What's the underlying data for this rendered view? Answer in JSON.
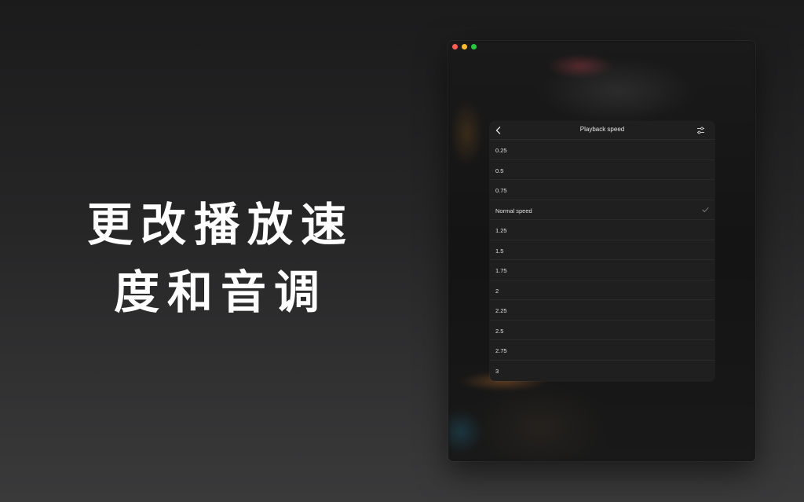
{
  "promo": {
    "headline_line1": "更改播放速",
    "headline_line2": "度和音调"
  },
  "window": {
    "traffic_lights": [
      "close",
      "minimize",
      "maximize"
    ]
  },
  "panel": {
    "title": "Playback speed",
    "back_icon": "chevron-left-icon",
    "settings_icon": "sliders-icon",
    "selected": "Normal speed",
    "options": [
      {
        "label": "0.25"
      },
      {
        "label": "0.5"
      },
      {
        "label": "0.75"
      },
      {
        "label": "Normal speed",
        "selected": true
      },
      {
        "label": "1.25"
      },
      {
        "label": "1.5"
      },
      {
        "label": "1.75"
      },
      {
        "label": "2"
      },
      {
        "label": "2.25"
      },
      {
        "label": "2.5"
      },
      {
        "label": "2.75"
      },
      {
        "label": "3"
      }
    ]
  },
  "colors": {
    "close": "#ff5f57",
    "minimize": "#febc2e",
    "maximize": "#28c840",
    "panel_bg": "#1f1f1f",
    "text": "#e2e2e2"
  }
}
